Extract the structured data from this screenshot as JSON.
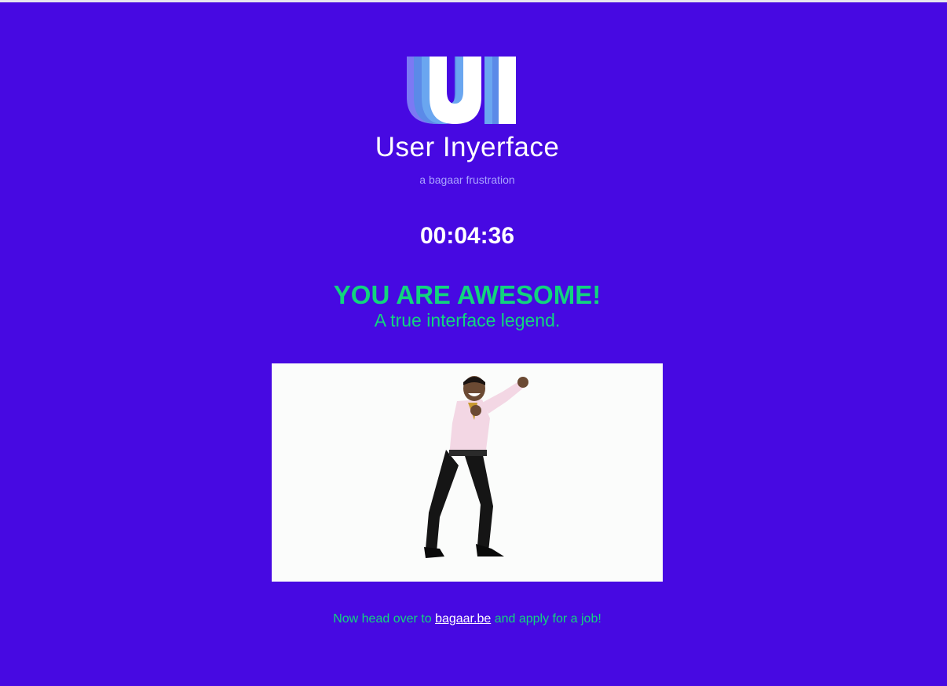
{
  "brand": {
    "logo_mark": "UI",
    "name": "User Inyerface",
    "tagline": "a bagaar frustration"
  },
  "timer": {
    "value": "00:04:36"
  },
  "result": {
    "headline": "YOU ARE AWESOME!",
    "subheadline": "A true interface legend."
  },
  "celebration_image": {
    "alt": "dancing man celebration"
  },
  "footer": {
    "prefix": "Now head over to",
    "link_text": "bagaar.be",
    "suffix": "and apply for a job!"
  },
  "colors": {
    "background": "#4709e2",
    "accent_green": "#12d47e",
    "tagline": "#a9a3ff",
    "white": "#ffffff"
  }
}
